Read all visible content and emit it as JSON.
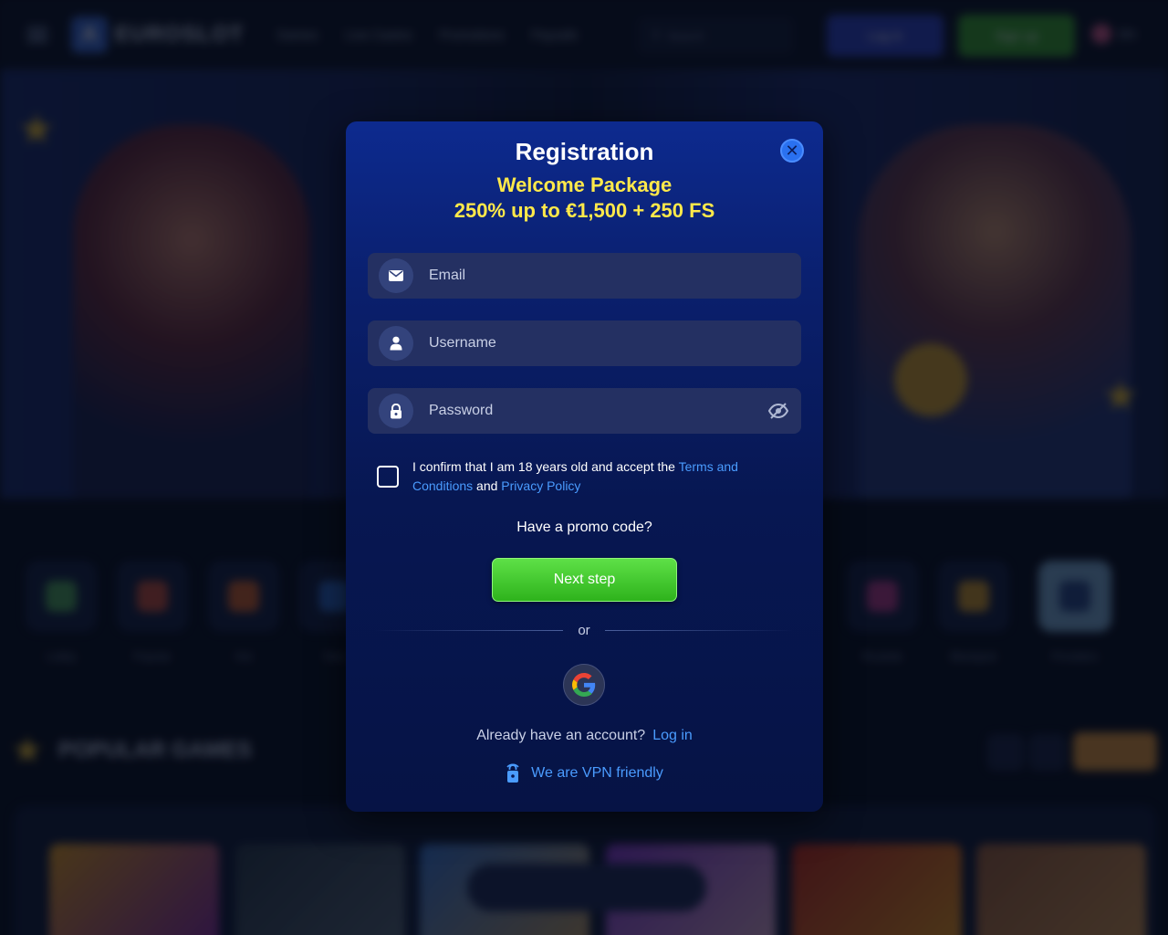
{
  "background": {
    "brand": "EUROSLOT",
    "nav": [
      "Games",
      "Live Casino",
      "Promotions",
      "Paysafe"
    ],
    "search_placeholder": "Search",
    "login_label": "Log in",
    "signup_label": "Sign up",
    "language": "EN",
    "categories": [
      "Lobby",
      "Popular",
      "Hot",
      "New",
      "Roulette",
      "Blackjack",
      "Providers"
    ],
    "popular_title": "POPULAR GAMES"
  },
  "modal": {
    "title": "Registration",
    "promo_line1": "Welcome Package",
    "promo_line2": "250% up to €1,500 + 250 FS",
    "email_placeholder": "Email",
    "username_placeholder": "Username",
    "password_placeholder": "Password",
    "consent_prefix": "I confirm that I am 18 years old and accept the ",
    "terms_link": "Terms and Conditions",
    "consent_and": " and ",
    "privacy_link": "Privacy Policy",
    "promo_question": "Have a promo code?",
    "next_button": "Next step",
    "or_label": "or",
    "have_account": "Already have an account?",
    "login_link": "Log in",
    "vpn_text": "We are VPN friendly"
  },
  "colors": {
    "accent_blue": "#2a71f0",
    "link_blue": "#4a9cff",
    "promo_yellow": "#ffe94a",
    "next_green": "#3fcb2c"
  }
}
